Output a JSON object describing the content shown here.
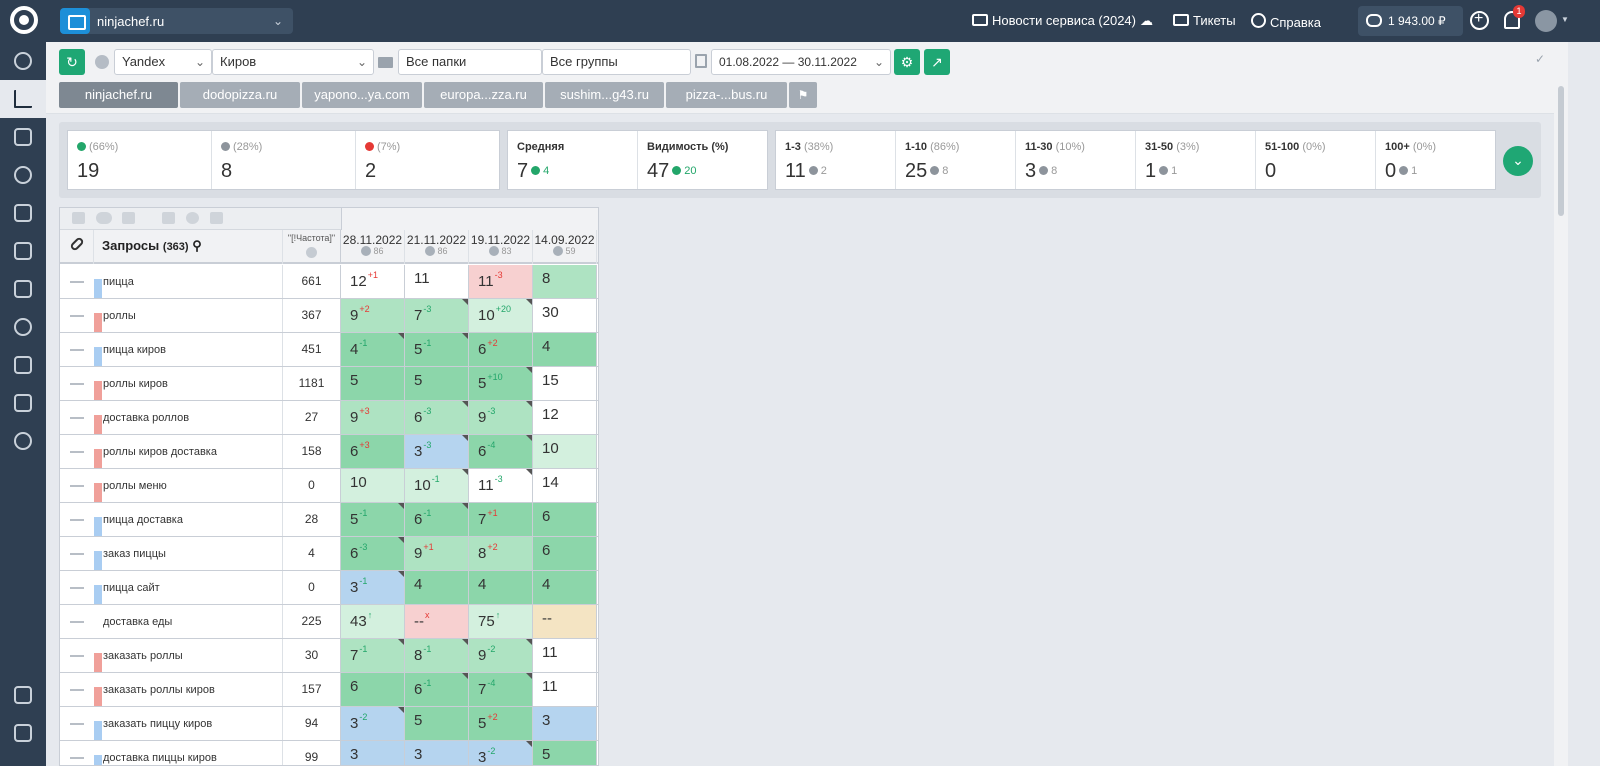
{
  "topbar": {
    "project": "ninjachef.ru",
    "news": "Новости сервиса (2024)",
    "tickets": "Тикеты",
    "help": "Справка",
    "balance": "1 943.00 ₽",
    "notifications": "1"
  },
  "sidebar": {
    "items": [
      "dashboard-icon",
      "positions-icon",
      "site-audit-icon",
      "trophy-icon",
      "analytics-icon",
      "tools-icon",
      "reports-icon",
      "bug-icon",
      "monitor-icon",
      "sitemap-icon",
      "settings-icon",
      "logout-icon",
      "external-icon"
    ]
  },
  "filters": {
    "search_engine": "Yandex",
    "region": "Киров",
    "folders": "Все папки",
    "groups": "Все группы",
    "date_range": "01.08.2022 — 30.11.2022"
  },
  "tabs": [
    "ninjachef.ru",
    "dodopizza.ru",
    "yapono...ya.com",
    "europa...zza.ru",
    "sushim...g43.ru",
    "pizza-...bus.ru"
  ],
  "stats": {
    "up": {
      "pct": "(66%)",
      "value": "19"
    },
    "same": {
      "pct": "(28%)",
      "value": "8"
    },
    "down": {
      "pct": "(7%)",
      "value": "2"
    },
    "average": {
      "label": "Средняя",
      "value": "7",
      "delta": "4"
    },
    "visibility": {
      "label": "Видимость (%)",
      "value": "47",
      "delta": "20"
    },
    "ranges": [
      {
        "label": "1-3",
        "pct": "(38%)",
        "value": "11",
        "delta": "2"
      },
      {
        "label": "1-10",
        "pct": "(86%)",
        "value": "25",
        "delta": "8"
      },
      {
        "label": "11-30",
        "pct": "(10%)",
        "value": "3",
        "delta": "8"
      },
      {
        "label": "31-50",
        "pct": "(3%)",
        "value": "1",
        "delta": "1"
      },
      {
        "label": "51-100",
        "pct": "(0%)",
        "value": "0",
        "delta": ""
      },
      {
        "label": "100+",
        "pct": "(0%)",
        "value": "0",
        "delta": "1"
      }
    ]
  },
  "table": {
    "title": "Запросы",
    "count": "(363)",
    "freq_header": "\"[!Частота]\"",
    "dates": [
      {
        "date": "28.11.2022",
        "vis": "86"
      },
      {
        "date": "21.11.2022",
        "vis": "86"
      },
      {
        "date": "19.11.2022",
        "vis": "83"
      },
      {
        "date": "14.09.2022",
        "vis": "59"
      }
    ],
    "rows": [
      {
        "query": "пицца",
        "freq": "661",
        "bar": "blue",
        "cells": [
          [
            "12",
            "+1",
            "down",
            "c-top"
          ],
          [
            "11",
            "",
            "",
            "c-top"
          ],
          [
            "11",
            "-3",
            "down",
            "c-pink"
          ],
          [
            "8",
            "",
            "",
            "c-md"
          ]
        ]
      },
      {
        "query": "роллы",
        "freq": "367",
        "bar": "red",
        "cells": [
          [
            "9",
            "+2",
            "down",
            "c-md"
          ],
          [
            "7",
            "-3",
            "up",
            "c-md"
          ],
          [
            "10",
            "+20",
            "up",
            "c-lt"
          ],
          [
            "30",
            "",
            "",
            "c-wht"
          ]
        ]
      },
      {
        "query": "пицца киров",
        "freq": "451",
        "bar": "blue",
        "cells": [
          [
            "4",
            "-1",
            "up",
            "c-dk"
          ],
          [
            "5",
            "-1",
            "up",
            "c-dk"
          ],
          [
            "6",
            "+2",
            "down",
            "c-dk"
          ],
          [
            "4",
            "",
            "",
            "c-dk"
          ]
        ]
      },
      {
        "query": "роллы киров",
        "freq": "1181",
        "bar": "red",
        "cells": [
          [
            "5",
            "",
            "",
            "c-dk"
          ],
          [
            "5",
            "",
            "",
            "c-dk"
          ],
          [
            "5",
            "+10",
            "up",
            "c-dk"
          ],
          [
            "15",
            "",
            "",
            "c-wht"
          ]
        ]
      },
      {
        "query": "доставка роллов",
        "freq": "27",
        "bar": "red",
        "cells": [
          [
            "9",
            "+3",
            "down",
            "c-md"
          ],
          [
            "6",
            "-3",
            "up",
            "c-md"
          ],
          [
            "9",
            "-3",
            "up",
            "c-md"
          ],
          [
            "12",
            "",
            "",
            "c-wht"
          ]
        ]
      },
      {
        "query": "роллы киров доставка",
        "freq": "158",
        "bar": "red",
        "cells": [
          [
            "6",
            "+3",
            "down",
            "c-dk"
          ],
          [
            "3",
            "-3",
            "up",
            "c-blue"
          ],
          [
            "6",
            "-4",
            "up",
            "c-dk"
          ],
          [
            "10",
            "",
            "",
            "c-lt"
          ]
        ]
      },
      {
        "query": "роллы меню",
        "freq": "0",
        "bar": "red",
        "cells": [
          [
            "10",
            "",
            "",
            "c-lt"
          ],
          [
            "10",
            "-1",
            "up",
            "c-lt"
          ],
          [
            "11",
            "-3",
            "up",
            "c-top"
          ],
          [
            "14",
            "",
            "",
            "c-wht"
          ]
        ]
      },
      {
        "query": "пицца доставка",
        "freq": "28",
        "bar": "blue",
        "cells": [
          [
            "5",
            "-1",
            "up",
            "c-dk"
          ],
          [
            "6",
            "-1",
            "up",
            "c-dk"
          ],
          [
            "7",
            "+1",
            "down",
            "c-dk"
          ],
          [
            "6",
            "",
            "",
            "c-dk"
          ]
        ]
      },
      {
        "query": "заказ пиццы",
        "freq": "4",
        "bar": "blue",
        "cells": [
          [
            "6",
            "-3",
            "up",
            "c-dk"
          ],
          [
            "9",
            "+1",
            "down",
            "c-md"
          ],
          [
            "8",
            "+2",
            "down",
            "c-md"
          ],
          [
            "6",
            "",
            "",
            "c-dk"
          ]
        ]
      },
      {
        "query": "пицца сайт",
        "freq": "0",
        "bar": "blue",
        "cells": [
          [
            "3",
            "-1",
            "up",
            "c-blue"
          ],
          [
            "4",
            "",
            "",
            "c-dk"
          ],
          [
            "4",
            "",
            "",
            "c-dk"
          ],
          [
            "4",
            "",
            "",
            "c-dk"
          ]
        ]
      },
      {
        "query": "доставка еды",
        "freq": "225",
        "bar": "",
        "cells": [
          [
            "43",
            "↑",
            "up",
            "c-lt"
          ],
          [
            "--",
            "x",
            "down",
            "c-pink"
          ],
          [
            "75",
            "↑",
            "up",
            "c-lt"
          ],
          [
            "--",
            "",
            "",
            "c-tan"
          ]
        ]
      },
      {
        "query": "заказать роллы",
        "freq": "30",
        "bar": "red",
        "cells": [
          [
            "7",
            "-1",
            "up",
            "c-md"
          ],
          [
            "8",
            "-1",
            "up",
            "c-md"
          ],
          [
            "9",
            "-2",
            "up",
            "c-md"
          ],
          [
            "11",
            "",
            "",
            "c-wht"
          ]
        ]
      },
      {
        "query": "заказать роллы киров",
        "freq": "157",
        "bar": "red",
        "cells": [
          [
            "6",
            "",
            "",
            "c-dk"
          ],
          [
            "6",
            "-1",
            "up",
            "c-dk"
          ],
          [
            "7",
            "-4",
            "up",
            "c-dk"
          ],
          [
            "11",
            "",
            "",
            "c-wht"
          ]
        ]
      },
      {
        "query": "заказать пиццу киров",
        "freq": "94",
        "bar": "blue",
        "cells": [
          [
            "3",
            "-2",
            "up",
            "c-blue"
          ],
          [
            "5",
            "",
            "",
            "c-dk"
          ],
          [
            "5",
            "+2",
            "down",
            "c-dk"
          ],
          [
            "3",
            "",
            "",
            "c-blue"
          ]
        ]
      },
      {
        "query": "доставка пиццы киров",
        "freq": "99",
        "bar": "blue",
        "cells": [
          [
            "3",
            "",
            "",
            "c-blue"
          ],
          [
            "3",
            "",
            "",
            "c-blue"
          ],
          [
            "3",
            "-2",
            "up",
            "c-blue"
          ],
          [
            "5",
            "",
            "",
            "c-dk"
          ]
        ]
      }
    ]
  }
}
